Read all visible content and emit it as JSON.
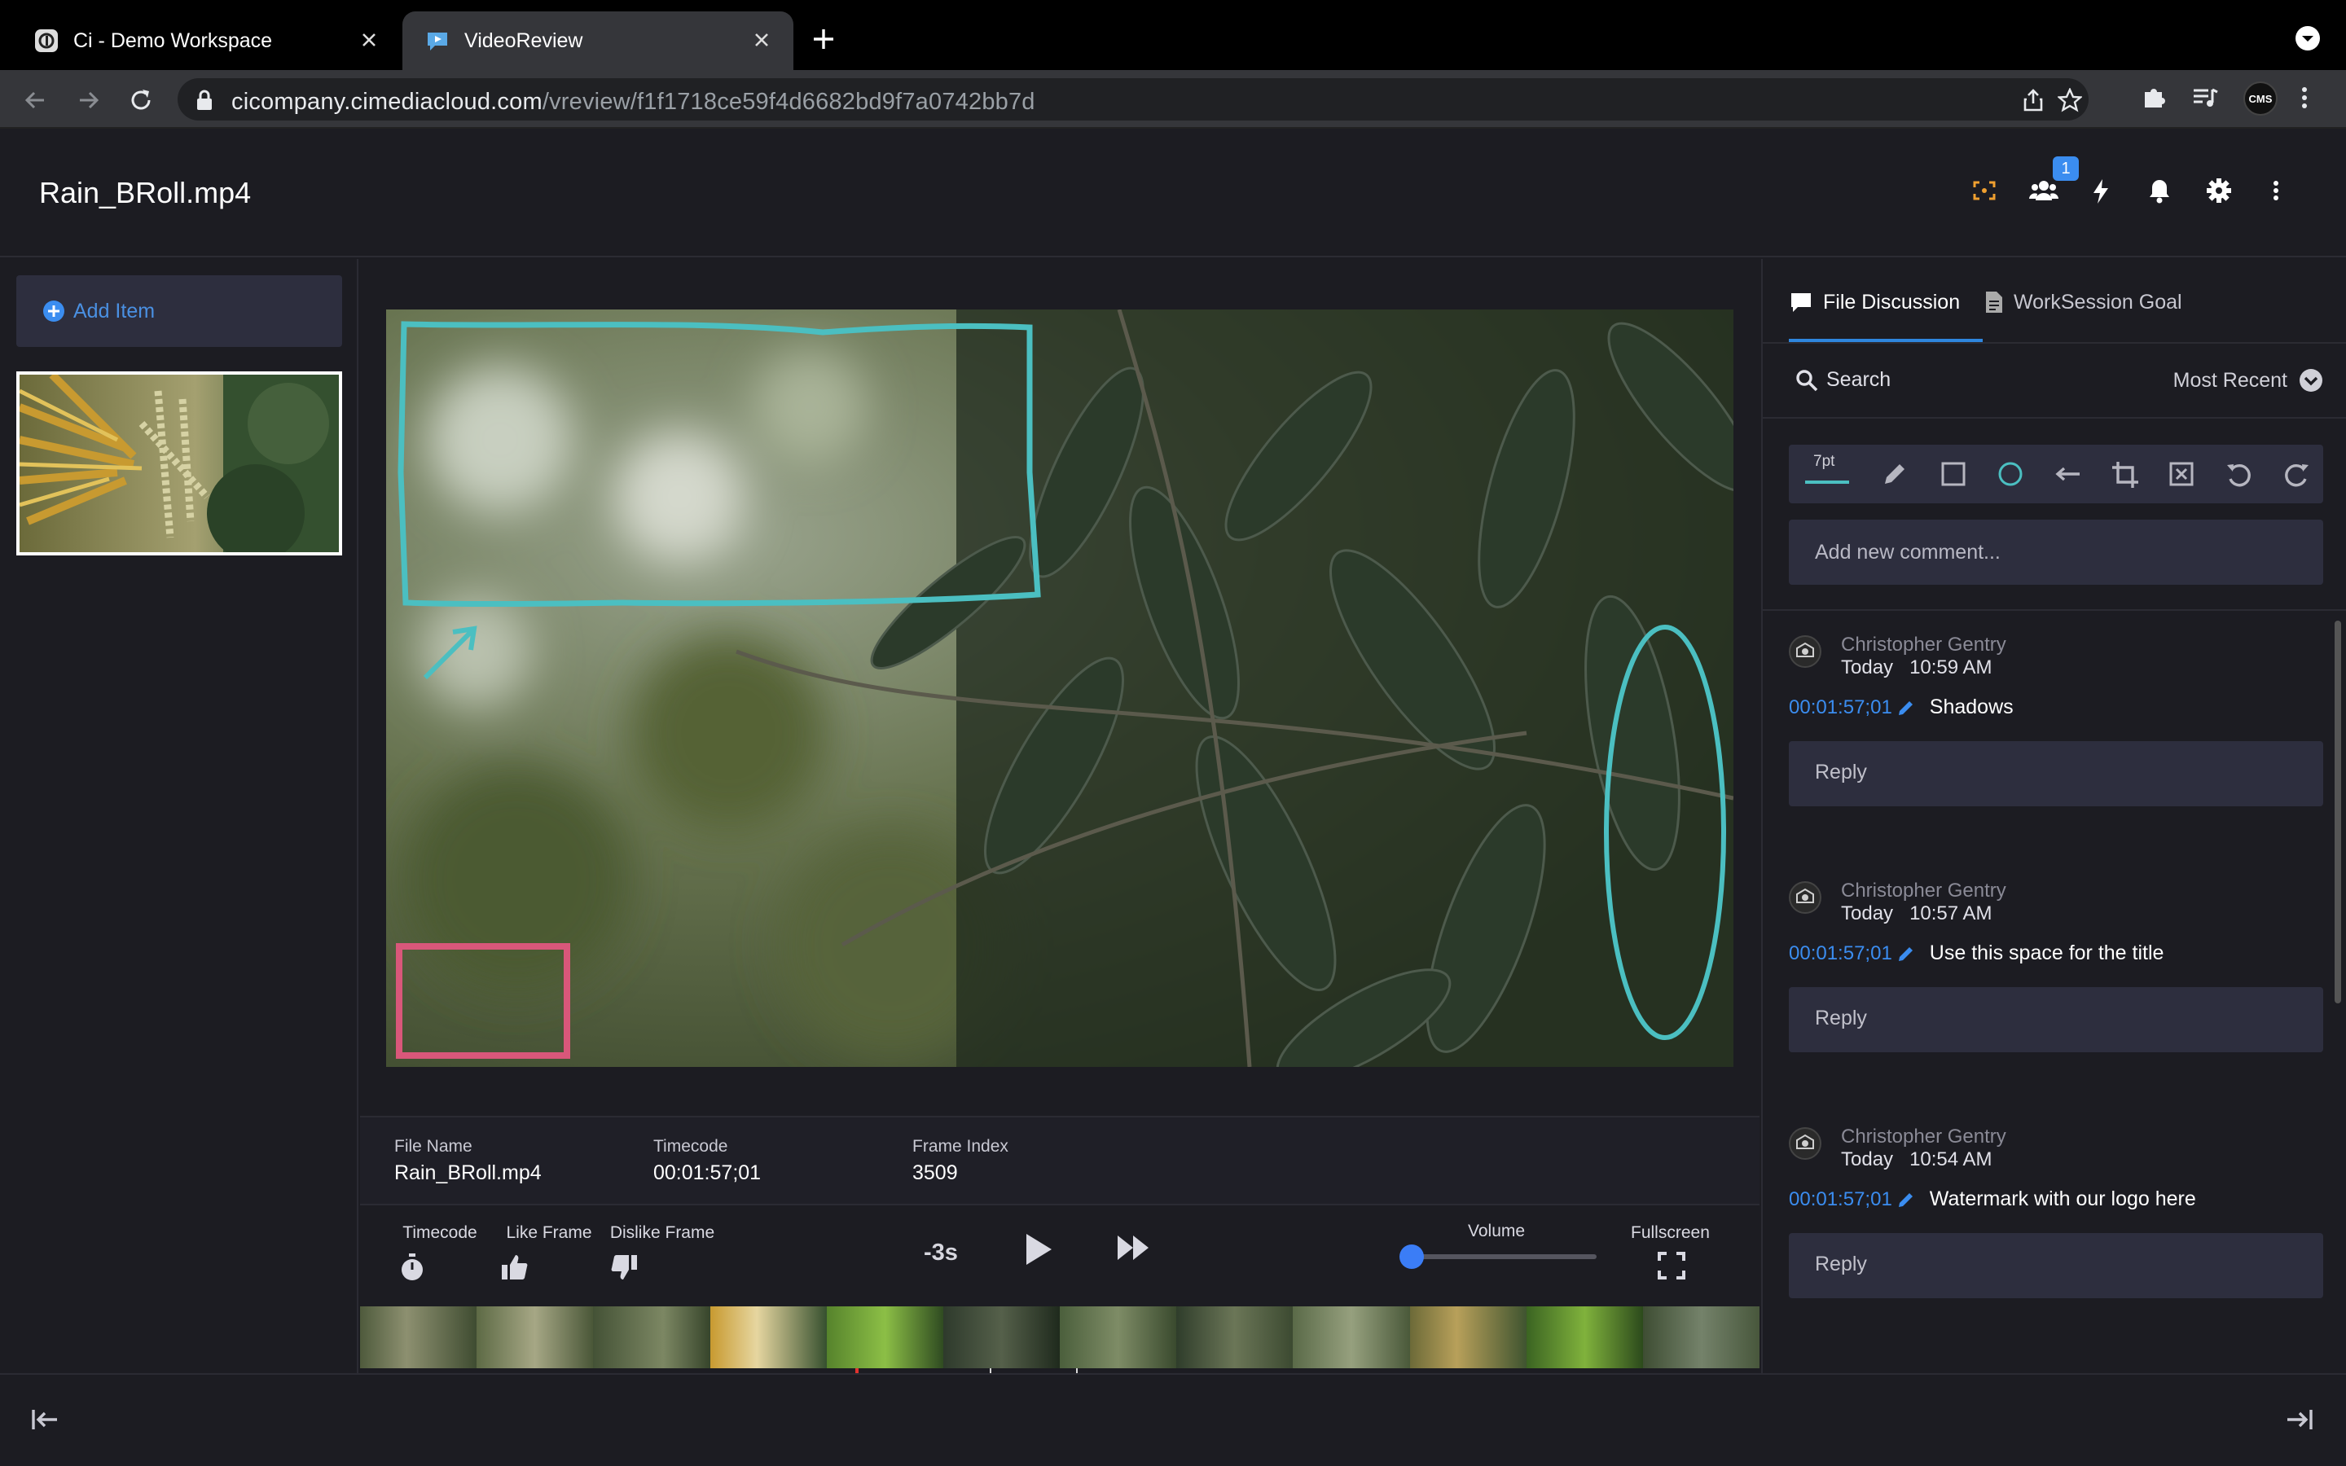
{
  "browser": {
    "tabs": [
      {
        "title": "Ci - Demo Workspace",
        "icon": "ci-logo-icon"
      },
      {
        "title": "VideoReview",
        "icon": "video-review-icon",
        "active": true
      }
    ],
    "url_host": "cicompany.cimediacloud.com",
    "url_path": "/vreview/f1f1718ce59f4d6682bd9f7a0742bb7d",
    "profile_initials": "CMS"
  },
  "header": {
    "file_title": "Rain_BRoll.mp4",
    "users_badge": "1",
    "colors": {
      "accent_orange": "#f0a030",
      "badge_blue": "#3b8df0"
    }
  },
  "sidebar": {
    "add_item_label": "Add Item"
  },
  "player": {
    "info": {
      "file_name_label": "File Name",
      "file_name_value": "Rain_BRoll.mp4",
      "timecode_label": "Timecode",
      "timecode_value": "00:01:57;01",
      "frame_index_label": "Frame Index",
      "frame_index_value": "3509"
    },
    "controls": {
      "timecode_label": "Timecode",
      "like_label": "Like Frame",
      "dislike_label": "Dislike Frame",
      "rewind_label": "-3s",
      "volume_label": "Volume",
      "volume_level": 0.0,
      "fullscreen_label": "Fullscreen"
    },
    "annotation_colors": {
      "teal": "#4bbfc1",
      "pink": "#d9577a"
    }
  },
  "discussion": {
    "tabs": [
      {
        "label": "File Discussion",
        "active": true
      },
      {
        "label": "WorkSession Goal"
      }
    ],
    "search_label": "Search",
    "sort_label": "Most Recent",
    "brush_size": "7pt",
    "new_comment_placeholder": "Add new comment...",
    "reply_label": "Reply",
    "comments": [
      {
        "author": "Christopher Gentry",
        "day": "Today",
        "time": "10:59 AM",
        "timecode": "00:01:57;01",
        "text": "Shadows"
      },
      {
        "author": "Christopher Gentry",
        "day": "Today",
        "time": "10:57 AM",
        "timecode": "00:01:57;01",
        "text": "Use this space for the title"
      },
      {
        "author": "Christopher Gentry",
        "day": "Today",
        "time": "10:54 AM",
        "timecode": "00:01:57;01",
        "text": "Watermark with our logo here"
      }
    ]
  }
}
